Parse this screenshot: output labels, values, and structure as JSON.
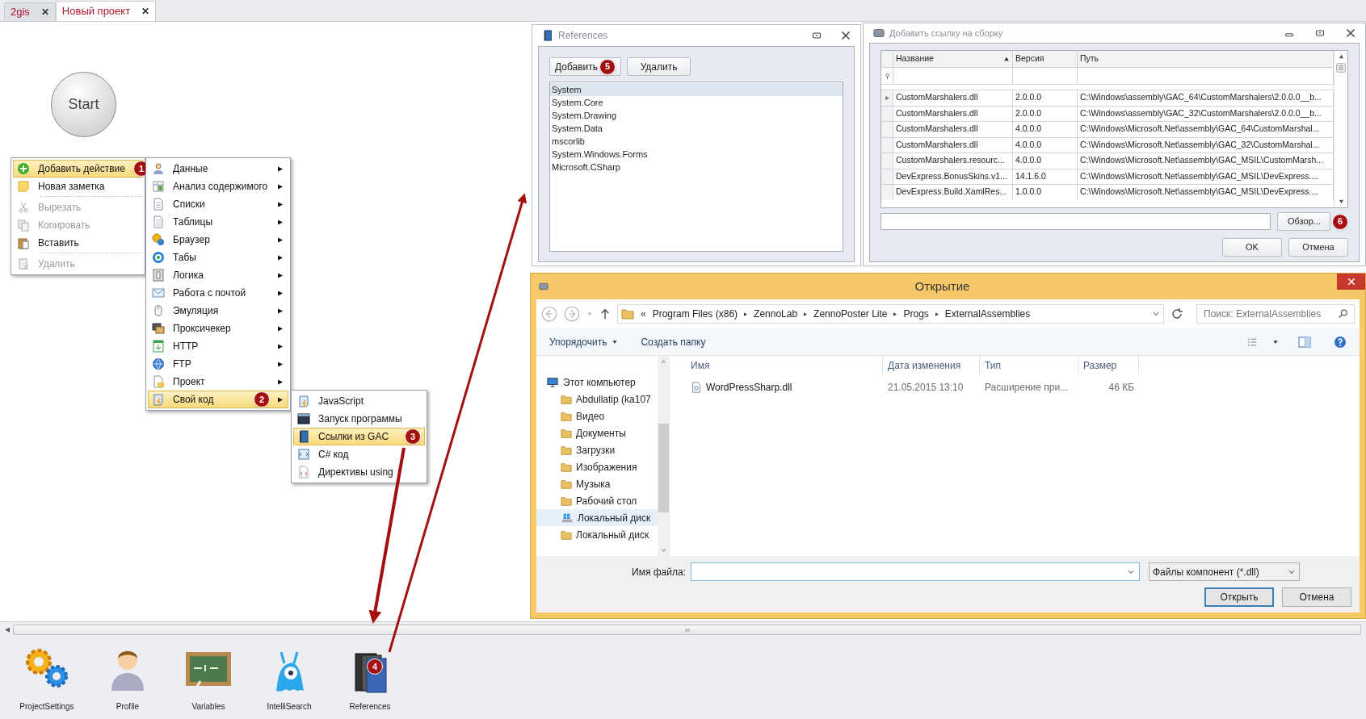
{
  "tabs": [
    {
      "label": "2gis",
      "close": "✕",
      "selected": false
    },
    {
      "label": "Новый проект",
      "close": "✕",
      "selected": true
    }
  ],
  "canvas": {
    "start_node": "Start"
  },
  "context_menu": {
    "items": [
      {
        "label": "Добавить действие",
        "disabled": false,
        "highlighted": true,
        "separator_before": false,
        "badge": "1"
      },
      {
        "label": "Новая заметка",
        "disabled": false,
        "highlighted": false,
        "separator_before": false
      },
      {
        "label": "Вырезать",
        "disabled": true,
        "highlighted": false,
        "separator_before": true
      },
      {
        "label": "Копировать",
        "disabled": true,
        "highlighted": false,
        "separator_before": false
      },
      {
        "label": "Вставить",
        "disabled": false,
        "highlighted": false,
        "separator_before": false
      },
      {
        "label": "Удалить",
        "disabled": true,
        "highlighted": false,
        "separator_before": true
      }
    ]
  },
  "action_submenu": {
    "items": [
      {
        "label": "Данные",
        "highlighted": false
      },
      {
        "label": "Анализ содержимого",
        "highlighted": false
      },
      {
        "label": "Списки",
        "highlighted": false
      },
      {
        "label": "Таблицы",
        "highlighted": false
      },
      {
        "label": "Браузер",
        "highlighted": false
      },
      {
        "label": "Табы",
        "highlighted": false
      },
      {
        "label": "Логика",
        "highlighted": false
      },
      {
        "label": "Работа с почтой",
        "highlighted": false
      },
      {
        "label": "Эмуляция",
        "highlighted": false
      },
      {
        "label": "Проксичекер",
        "highlighted": false
      },
      {
        "label": "HTTP",
        "highlighted": false
      },
      {
        "label": "FTP",
        "highlighted": false
      },
      {
        "label": "Проект",
        "highlighted": false
      },
      {
        "label": "Свой код",
        "highlighted": true,
        "badge": "2"
      }
    ]
  },
  "code_submenu": {
    "items": [
      {
        "label": "JavaScript",
        "highlighted": false
      },
      {
        "label": "Запуск программы",
        "highlighted": false
      },
      {
        "label": "Ссылки из GAC",
        "highlighted": true,
        "badge": "3"
      },
      {
        "label": "C# код",
        "highlighted": false
      },
      {
        "label": "Директивы using",
        "highlighted": false
      }
    ]
  },
  "references_window": {
    "title": "References",
    "buttons": [
      {
        "label": "Добавить",
        "badge": "5"
      },
      {
        "label": "Удалить"
      }
    ],
    "items": [
      {
        "label": "System",
        "selected": true
      },
      {
        "label": "System.Core",
        "selected": false
      },
      {
        "label": "System.Drawing",
        "selected": false
      },
      {
        "label": "System.Data",
        "selected": false
      },
      {
        "label": "mscorlib",
        "selected": false
      },
      {
        "label": "System.Windows.Forms",
        "selected": false
      },
      {
        "label": "Microsoft.CSharp",
        "selected": false
      }
    ]
  },
  "add_reference_window": {
    "title": "Добавить ссылку на сборку",
    "columns": [
      {
        "label": "Название",
        "sorted": true
      },
      {
        "label": "Версия",
        "sorted": false
      },
      {
        "label": "Путь",
        "sorted": false
      }
    ],
    "rows": [
      {
        "cells": [
          "CustomMarshalers.dll",
          "2.0.0.0",
          "C:\\Windows\\assembly\\GAC_64\\CustomMarshalers\\2.0.0.0__b..."
        ],
        "selected": true
      },
      {
        "cells": [
          "CustomMarshalers.dll",
          "2.0.0.0",
          "C:\\Windows\\assembly\\GAC_32\\CustomMarshalers\\2.0.0.0__b..."
        ],
        "selected": false
      },
      {
        "cells": [
          "CustomMarshalers.dll",
          "4.0.0.0",
          "C:\\Windows\\Microsoft.Net\\assembly\\GAC_64\\CustomMarshal..."
        ],
        "selected": false
      },
      {
        "cells": [
          "CustomMarshalers.dll",
          "4.0.0.0",
          "C:\\Windows\\Microsoft.Net\\assembly\\GAC_32\\CustomMarshal..."
        ],
        "selected": false
      },
      {
        "cells": [
          "CustomMarshalers.resourc...",
          "4.0.0.0",
          "C:\\Windows\\Microsoft.Net\\assembly\\GAC_MSIL\\CustomMarsh..."
        ],
        "selected": false
      },
      {
        "cells": [
          "DevExpress.BonusSkins.v1...",
          "14.1.6.0",
          "C:\\Windows\\Microsoft.Net\\assembly\\GAC_MSIL\\DevExpress...."
        ],
        "selected": false
      },
      {
        "cells": [
          "DevExpress.Build.XamlRes...",
          "1.0.0.0",
          "C:\\Windows\\Microsoft.Net\\assembly\\GAC_MSIL\\DevExpress...."
        ],
        "selected": false
      }
    ],
    "browse_button": {
      "label": "Обзор...",
      "badge": "6"
    },
    "buttons": [
      "OK",
      "Отмена"
    ]
  },
  "open_dialog": {
    "title": "Открытие",
    "path_overflow": "«",
    "path": [
      "Program Files (x86)",
      "ZennoLab",
      "ZennoPoster Lite",
      "Progs",
      "ExternalAssemblies"
    ],
    "search": {
      "placeholder": "Поиск: ExternalAssemblies"
    },
    "toolbar": [
      {
        "label": "Упорядочить",
        "dropdown": true
      },
      {
        "label": "Создать папку",
        "dropdown": false
      }
    ],
    "tree": [
      {
        "label": "Этот компьютер",
        "selected": false,
        "children": [
          {
            "label": "Abdullatip (ka107",
            "selected": false
          },
          {
            "label": "Видео",
            "selected": false
          },
          {
            "label": "Документы",
            "selected": false
          },
          {
            "label": "Загрузки",
            "selected": false
          },
          {
            "label": "Изображения",
            "selected": false
          },
          {
            "label": "Музыка",
            "selected": false
          },
          {
            "label": "Рабочий стол",
            "selected": false
          },
          {
            "label": "Локальный диск",
            "selected": true
          },
          {
            "label": "Локальный диск",
            "selected": false
          }
        ]
      }
    ],
    "columns": [
      "Имя",
      "Дата изменения",
      "Тип",
      "Размер"
    ],
    "files": [
      {
        "cells": [
          "WordPressSharp.dll",
          "21.05.2015 13:10",
          "Расширение при...",
          "46 КБ"
        ]
      }
    ],
    "file_name_label": "Имя файла:",
    "filter": "Файлы компонент (*.dll)",
    "buttons": [
      "Открыть",
      "Отмена"
    ]
  },
  "bottom_toolbar": [
    {
      "label": "ProjectSettings"
    },
    {
      "label": "Profile"
    },
    {
      "label": "Variables"
    },
    {
      "label": "IntelliSearch"
    },
    {
      "label": "References",
      "badge": "4"
    }
  ]
}
